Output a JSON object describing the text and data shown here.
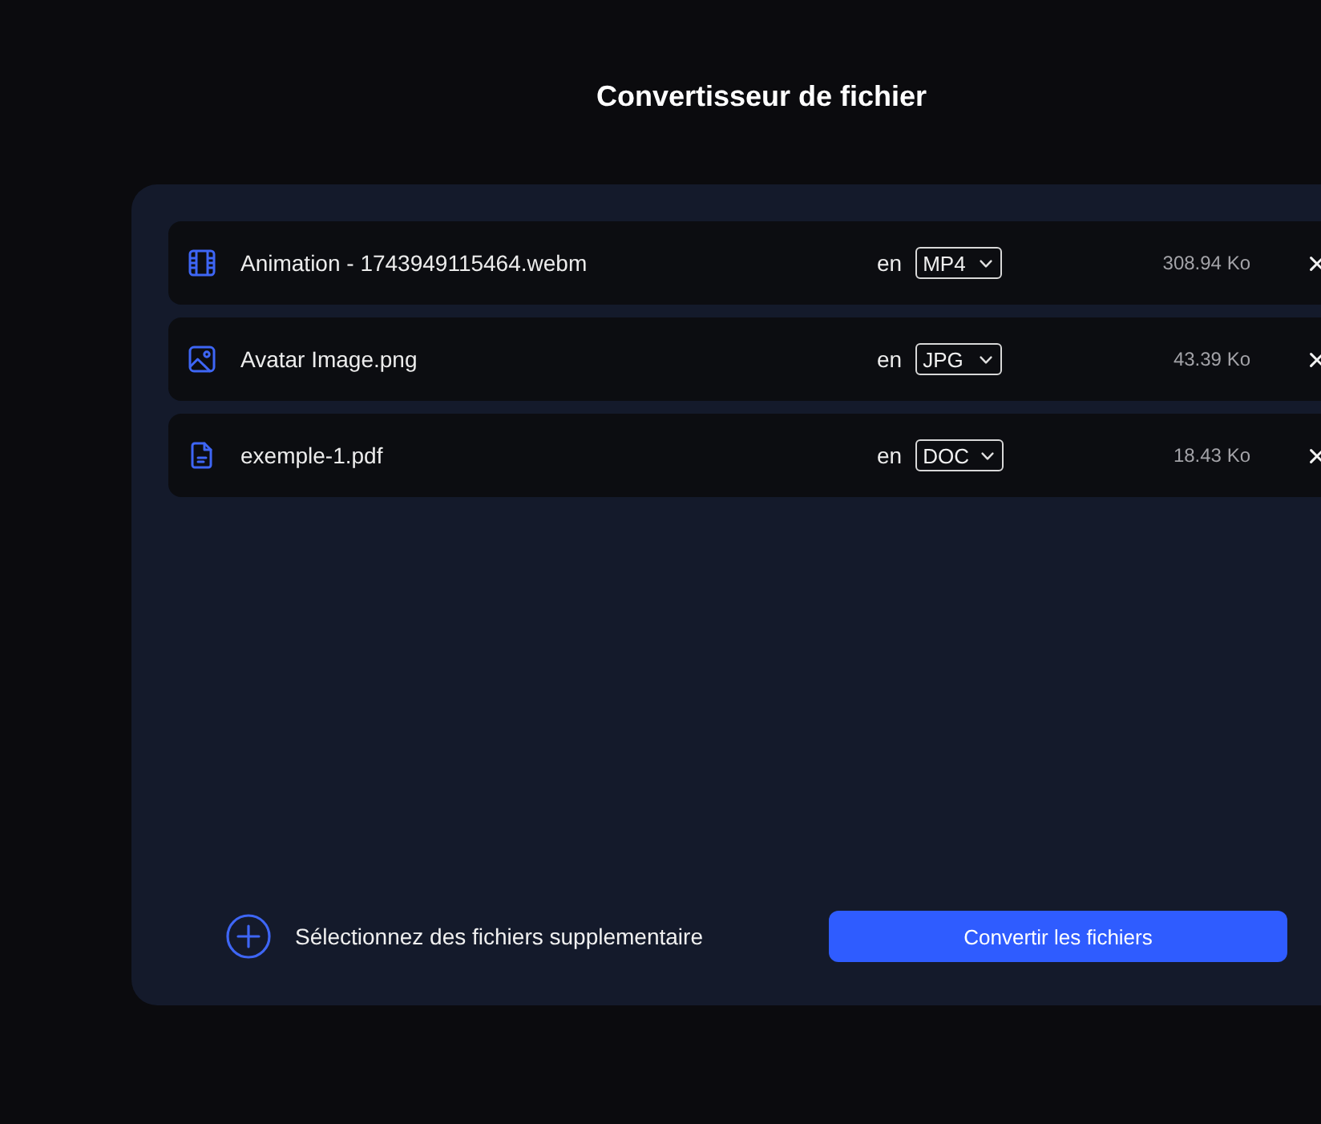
{
  "title": "Convertisseur de fichier",
  "files": [
    {
      "kind": "video",
      "name": "Animation - 1743949115464.webm",
      "prefix": "en",
      "format": "MP4",
      "size": "308.94 Ko"
    },
    {
      "kind": "image",
      "name": "Avatar Image.png",
      "prefix": "en",
      "format": "JPG",
      "size": "43.39 Ko"
    },
    {
      "kind": "document",
      "name": "exemple-1.pdf",
      "prefix": "en",
      "format": "DOC",
      "size": "18.43 Ko"
    }
  ],
  "footer": {
    "add_label": "Sélectionnez des fichiers supplementaire",
    "convert_button": "Convertir les fichiers"
  }
}
